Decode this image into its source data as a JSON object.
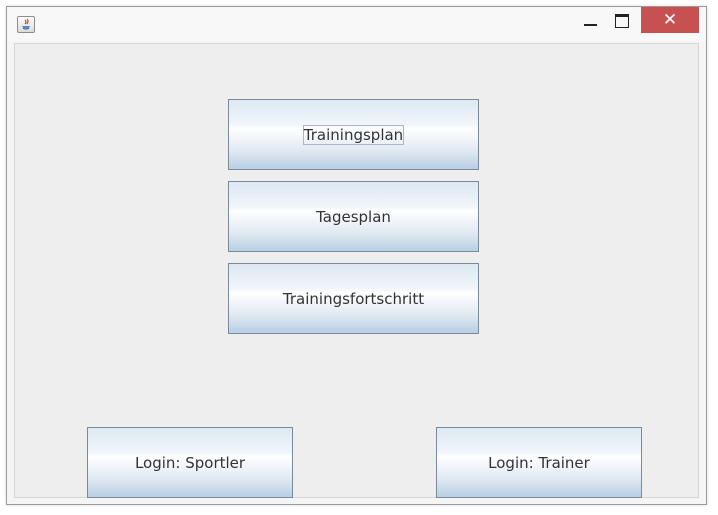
{
  "window": {
    "title": "",
    "icon": "java-icon",
    "controls": {
      "minimize": "minimize-icon",
      "maximize": "maximize-icon",
      "close": "✕",
      "close_color": "#c75050"
    }
  },
  "buttons": {
    "trainingsplan": "Trainingsplan",
    "tagesplan": "Tagesplan",
    "trainingsfortschritt": "Trainingsfortschritt",
    "login_sportler": "Login: Sportler",
    "login_trainer": "Login: Trainer"
  },
  "focused_button": "trainingsplan"
}
